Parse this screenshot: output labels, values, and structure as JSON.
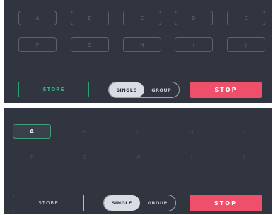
{
  "panels": [
    {
      "pads": [
        "A",
        "B",
        "C",
        "D",
        "E",
        "F",
        "G",
        "H",
        "I",
        "J"
      ],
      "active_pad": null,
      "store_label": "STORE",
      "toggle": {
        "single_label": "SINGLE",
        "group_label": "GROUP",
        "selected": "SINGLE"
      },
      "stop_label": "STOP"
    },
    {
      "pads": [
        "A",
        "B",
        "C",
        "D",
        "E",
        "F",
        "G",
        "H",
        "I",
        "J"
      ],
      "active_pad": "A",
      "store_label": "STORE",
      "toggle": {
        "single_label": "SINGLE",
        "group_label": "GROUP",
        "selected": "SINGLE"
      },
      "stop_label": "STOP"
    }
  ],
  "colors": {
    "panel_background": "#31353f",
    "store_accent": "#2f9e74",
    "stop_accent": "#ee4f6b",
    "active_pad_border": "#3f9f78"
  }
}
